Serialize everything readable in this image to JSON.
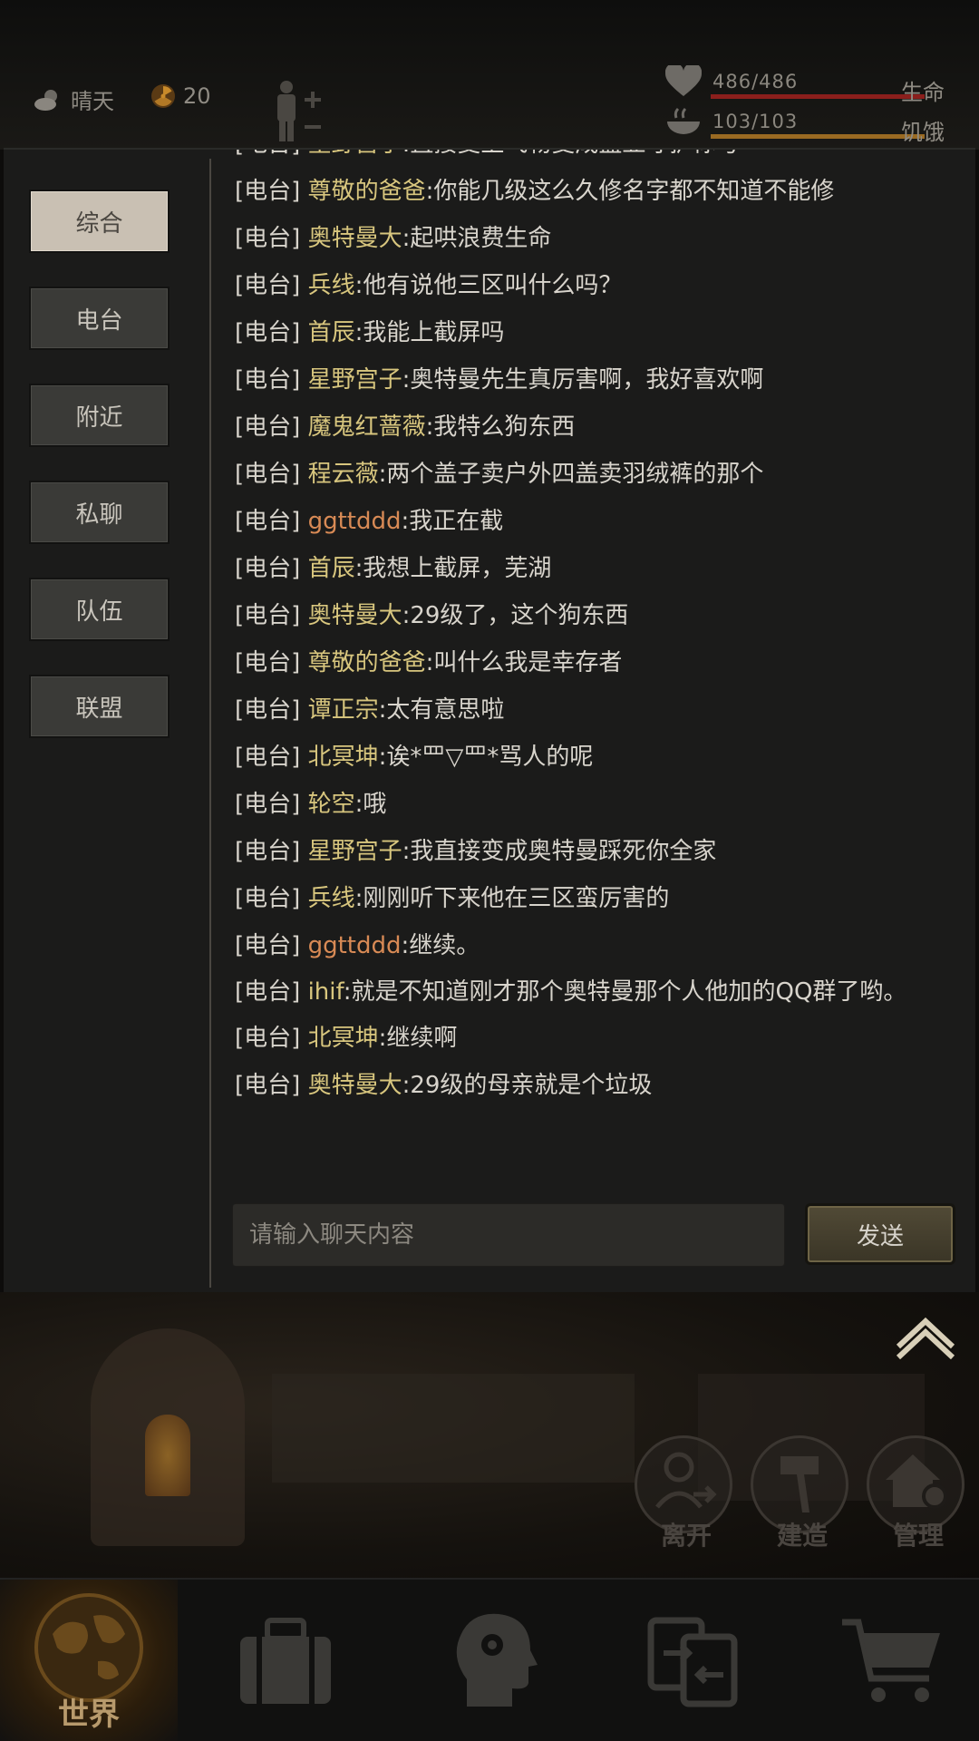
{
  "hud": {
    "weather_label": "晴天",
    "radiation_value": "20",
    "hp": {
      "value": "486/486",
      "label": "生命",
      "fill": 1.0
    },
    "hunger": {
      "value": "103/103",
      "label": "饥饿",
      "fill": 1.0
    }
  },
  "tabs": [
    {
      "label": "综合",
      "active": true
    },
    {
      "label": "电台",
      "active": false
    },
    {
      "label": "附近",
      "active": false
    },
    {
      "label": "私聊",
      "active": false
    },
    {
      "label": "队伍",
      "active": false
    },
    {
      "label": "联盟",
      "active": false
    }
  ],
  "messages": [
    {
      "channel": "[电台]",
      "name": "星野宫子",
      "text": ":直接变上飞物变成盖亚守护你号"
    },
    {
      "channel": "[电台]",
      "name": "尊敬的爸爸",
      "text": ":你能几级这么久修名字都不知道不能修"
    },
    {
      "channel": "[电台]",
      "name": "奥特曼大",
      "text": ":起哄浪费生命"
    },
    {
      "channel": "[电台]",
      "name": "兵线",
      "text": ":他有说他三区叫什么吗？"
    },
    {
      "channel": "[电台]",
      "name": "首辰",
      "text": ":我能上截屏吗"
    },
    {
      "channel": "[电台]",
      "name": "星野宫子",
      "text": ":奥特曼先生真厉害啊，我好喜欢啊"
    },
    {
      "channel": "[电台]",
      "name": "魔鬼红蔷薇",
      "text": ":我特么狗东西"
    },
    {
      "channel": "[电台]",
      "name": "程云薇",
      "text": ":两个盖子卖户外四盖卖羽绒裤的那个"
    },
    {
      "channel": "[电台]",
      "name": "ggttddd",
      "text": ":我正在截",
      "name_color": "orange"
    },
    {
      "channel": "[电台]",
      "name": "首辰",
      "text": ":我想上截屏，芜湖"
    },
    {
      "channel": "[电台]",
      "name": "奥特曼大",
      "text": ":29级了，这个狗东西"
    },
    {
      "channel": "[电台]",
      "name": "尊敬的爸爸",
      "text": ":叫什么我是幸存者"
    },
    {
      "channel": "[电台]",
      "name": "谭正宗",
      "text": ":太有意思啦"
    },
    {
      "channel": "[电台]",
      "name": "北冥坤",
      "text": ":诶*罒▽罒*骂人的呢"
    },
    {
      "channel": "[电台]",
      "name": "轮空",
      "text": ":哦"
    },
    {
      "channel": "[电台]",
      "name": "星野宫子",
      "text": ":我直接变成奥特曼踩死你全家"
    },
    {
      "channel": "[电台]",
      "name": "兵线",
      "text": ":刚刚听下来他在三区蛮厉害的"
    },
    {
      "channel": "[电台]",
      "name": "ggttddd",
      "text": ":继续。",
      "name_color": "orange"
    },
    {
      "channel": "[电台]",
      "name": "ihif",
      "text": ":就是不知道刚才那个奥特曼那个人他加的QQ群了哟。",
      "wrap": true
    },
    {
      "channel": "[电台]",
      "name": "北冥坤",
      "text": ":继续啊"
    },
    {
      "channel": "[电台]",
      "name": "奥特曼大",
      "text": ":29级的母亲就是个垃圾"
    }
  ],
  "input": {
    "placeholder": "请输入聊天内容",
    "value": ""
  },
  "send_label": "发送",
  "actions": {
    "leave": "离开",
    "build": "建造",
    "manage": "管理"
  },
  "nav": {
    "world": "世界"
  },
  "colors": {
    "name": "#d8c67e",
    "name_orange": "#d88a55",
    "hp_bar": "#8b1f1c",
    "hunger_bar": "#9a6a22"
  }
}
